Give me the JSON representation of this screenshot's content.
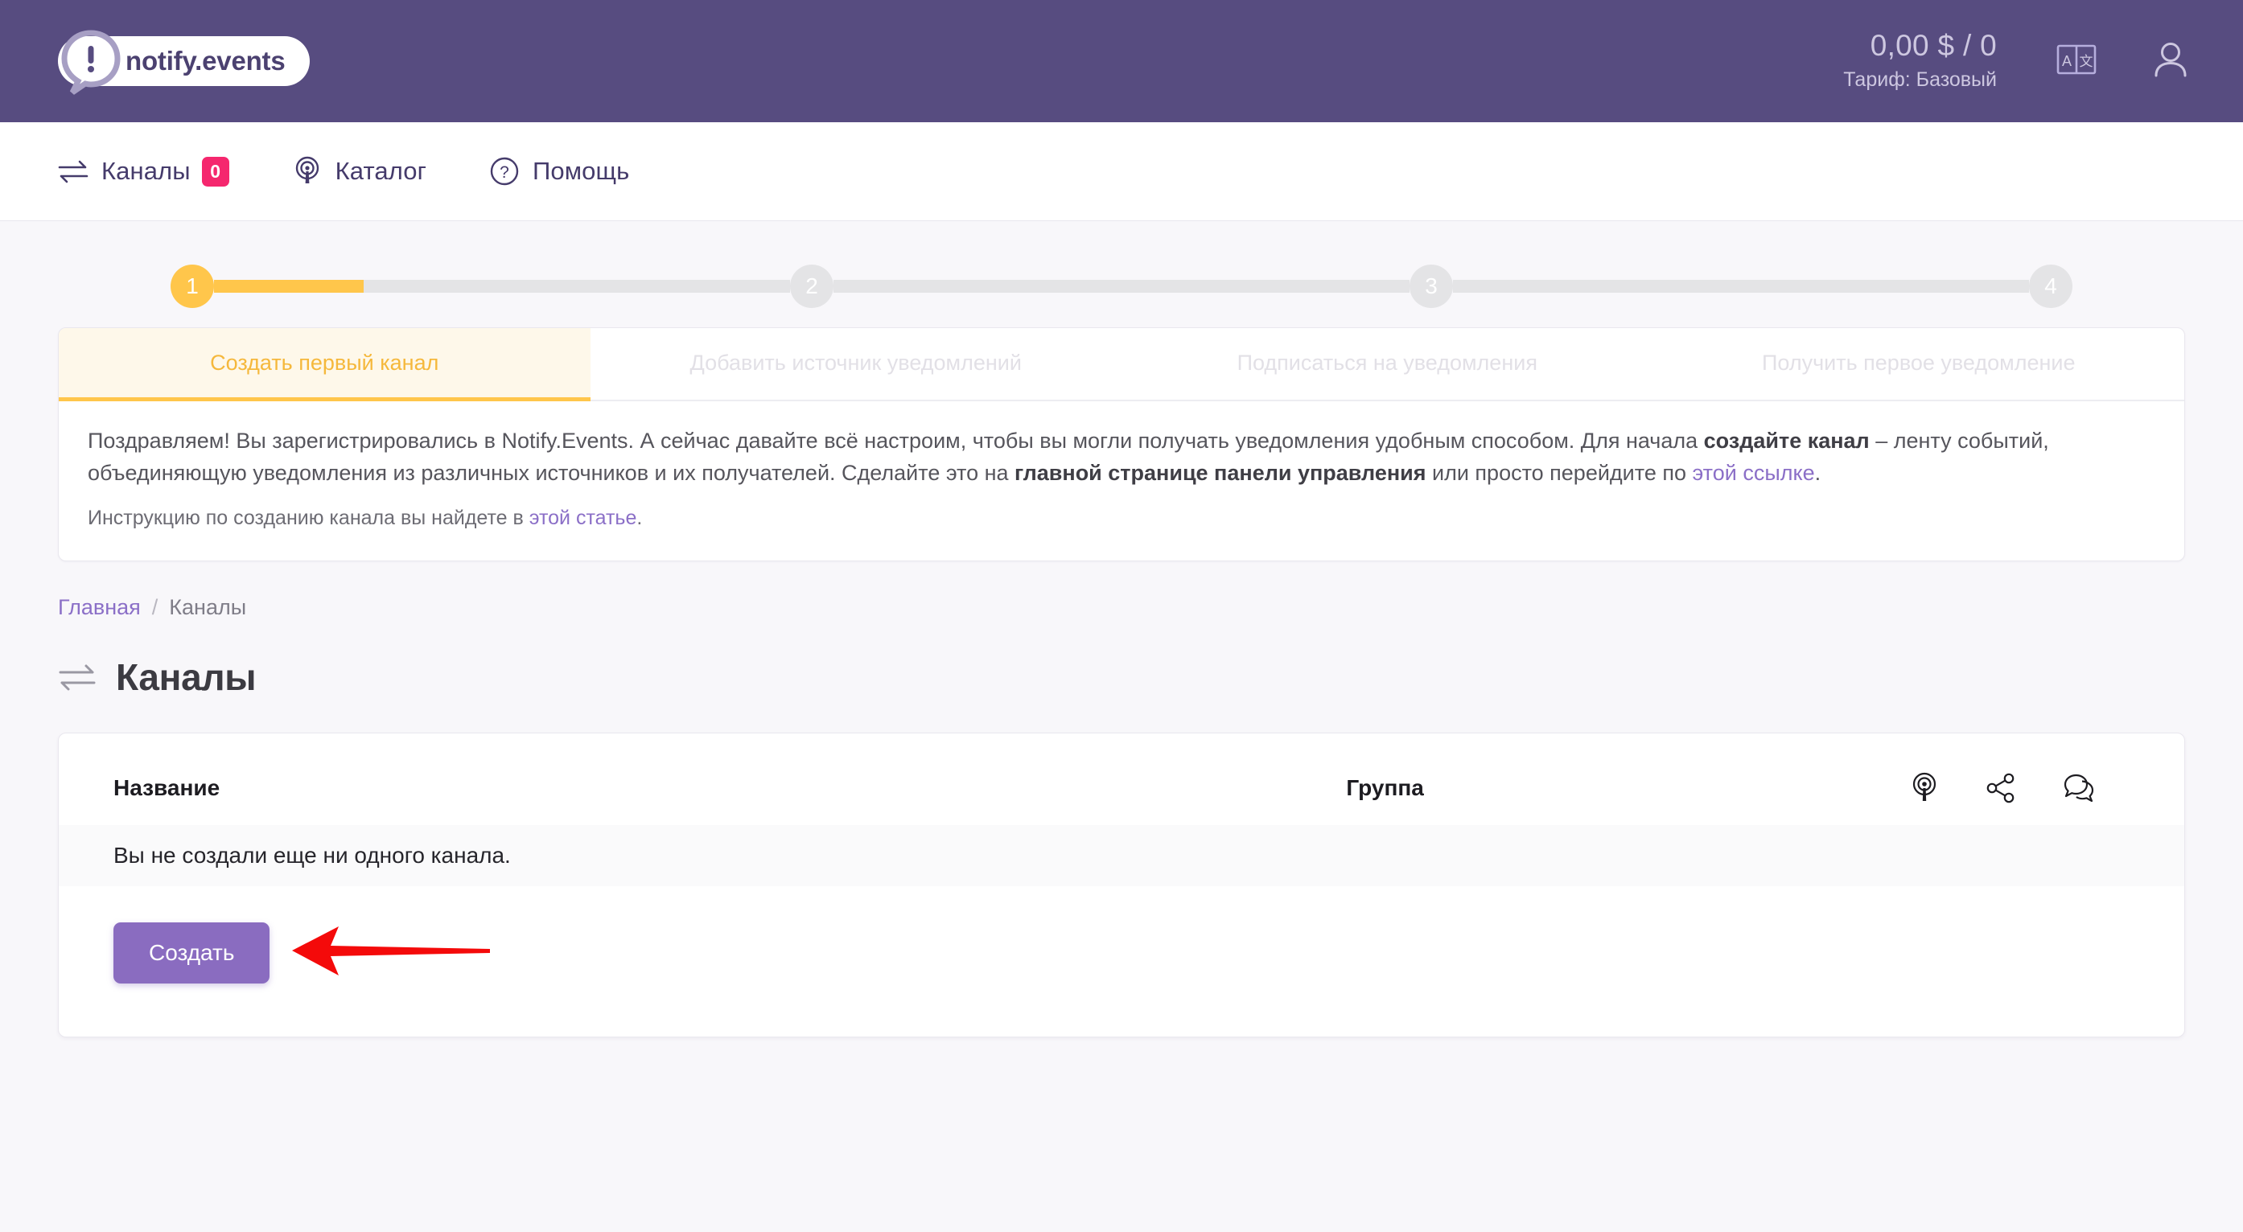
{
  "header": {
    "logo_text": "notify.events",
    "logo_icon": "exclamation-bubble-icon",
    "balance_amount": "0,00 $ / 0",
    "balance_plan": "Тариф: Базовый",
    "lang_icon": "language-translate-icon",
    "user_icon": "user-account-icon",
    "bg_color": "#574c80"
  },
  "nav": {
    "items": [
      {
        "label": "Каналы",
        "icon": "exchange-arrows-icon",
        "badge": "0"
      },
      {
        "label": "Каталог",
        "icon": "broadcast-icon",
        "badge": null
      },
      {
        "label": "Помощь",
        "icon": "question-circle-icon",
        "badge": null
      }
    ],
    "badge_color": "#f5276e"
  },
  "onboarding": {
    "stepper": {
      "steps": [
        "1",
        "2",
        "3",
        "4"
      ],
      "active_index": 0,
      "fill_percent": 26,
      "active_color": "#ffc64b",
      "inactive_color": "#e4e4e6"
    },
    "tabs": [
      {
        "label": "Создать первый канал",
        "active": true
      },
      {
        "label": "Добавить источник уведомлений",
        "active": false
      },
      {
        "label": "Подписаться на уведомления",
        "active": false
      },
      {
        "label": "Получить первое уведомление",
        "active": false
      }
    ],
    "paragraph": {
      "p1": "Поздравляем! Вы зарегистрировались в Notify.Events. А сейчас давайте всё настроим, чтобы вы могли получать уведомления удобным способом. Для начала ",
      "b1": "создайте канал",
      "p2": " – ленту событий, объединяющую уведомления из различных источников и их получателей. Сделайте это на ",
      "b2": "главной странице панели управления",
      "p3": " или просто перейдите по ",
      "link1": "этой ссылке",
      "p4": "."
    },
    "hint": {
      "prefix": "Инструкцию по созданию канала вы найдете в ",
      "link": "этой статье",
      "suffix": "."
    }
  },
  "breadcrumb": {
    "home": "Главная",
    "separator": "/",
    "current": "Каналы"
  },
  "page": {
    "title": "Каналы",
    "title_icon": "exchange-arrows-icon"
  },
  "table": {
    "columns": [
      "Название",
      "Группа"
    ],
    "action_icons": [
      "broadcast-icon",
      "share-nodes-icon",
      "chat-bubbles-icon"
    ],
    "empty_message": "Вы не создали еще ни одного канала."
  },
  "actions": {
    "create_label": "Создать",
    "create_color": "#8a6cc0",
    "annotation_arrow": "red-left-arrow-annotation"
  }
}
